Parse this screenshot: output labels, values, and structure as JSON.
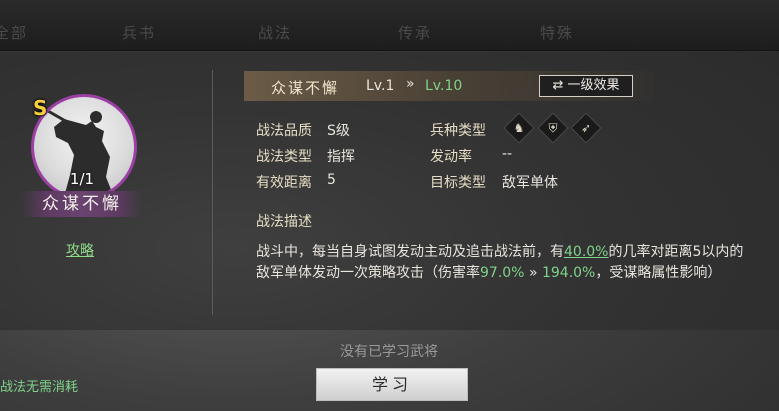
{
  "top_tabs": [
    "全部",
    "兵书",
    "战法",
    "传承",
    "特殊"
  ],
  "skill": {
    "grade": "S",
    "count": "1/1",
    "name": "众谋不懈",
    "strategy_link": "攻略"
  },
  "header": {
    "name": "众谋不懈",
    "level_current": "Lv.1",
    "arrow": "»",
    "level_max": "Lv.10",
    "effect_button": "一级效果",
    "effect_icon": "swap-arrows-icon"
  },
  "attributes": {
    "quality_label": "战法品质",
    "quality_value": "S级",
    "type_label": "战法类型",
    "type_value": "指挥",
    "range_label": "有效距离",
    "range_value": "5",
    "troop_label": "兵种类型",
    "troop_icons": [
      "cavalry-icon",
      "shield-icon",
      "bow-icon"
    ],
    "rate_label": "发动率",
    "rate_value": "--",
    "target_label": "目标类型",
    "target_value": "敌军单体"
  },
  "description": {
    "title": "战法描述",
    "line1_a": "战斗中，每当自身试图发动主动及追击战法前，有",
    "line1_pct": "40.0%",
    "line1_b": "的几率对距离5以内的",
    "line2_a": "敌军单体发动一次策略攻击（伤害率",
    "line2_v1": "97.0%",
    "line2_arrow": "»",
    "line2_v2": "194.0%",
    "line2_b": "，受谋略属性影响）"
  },
  "footer": {
    "no_learned": "没有已学习武将",
    "learn_button": "学习",
    "no_cost": "战法无需消耗"
  },
  "colors": {
    "accent_green": "#7fd28a",
    "grade_gold": "#f6cf3c",
    "portrait_ring": "#9b3fa5"
  }
}
